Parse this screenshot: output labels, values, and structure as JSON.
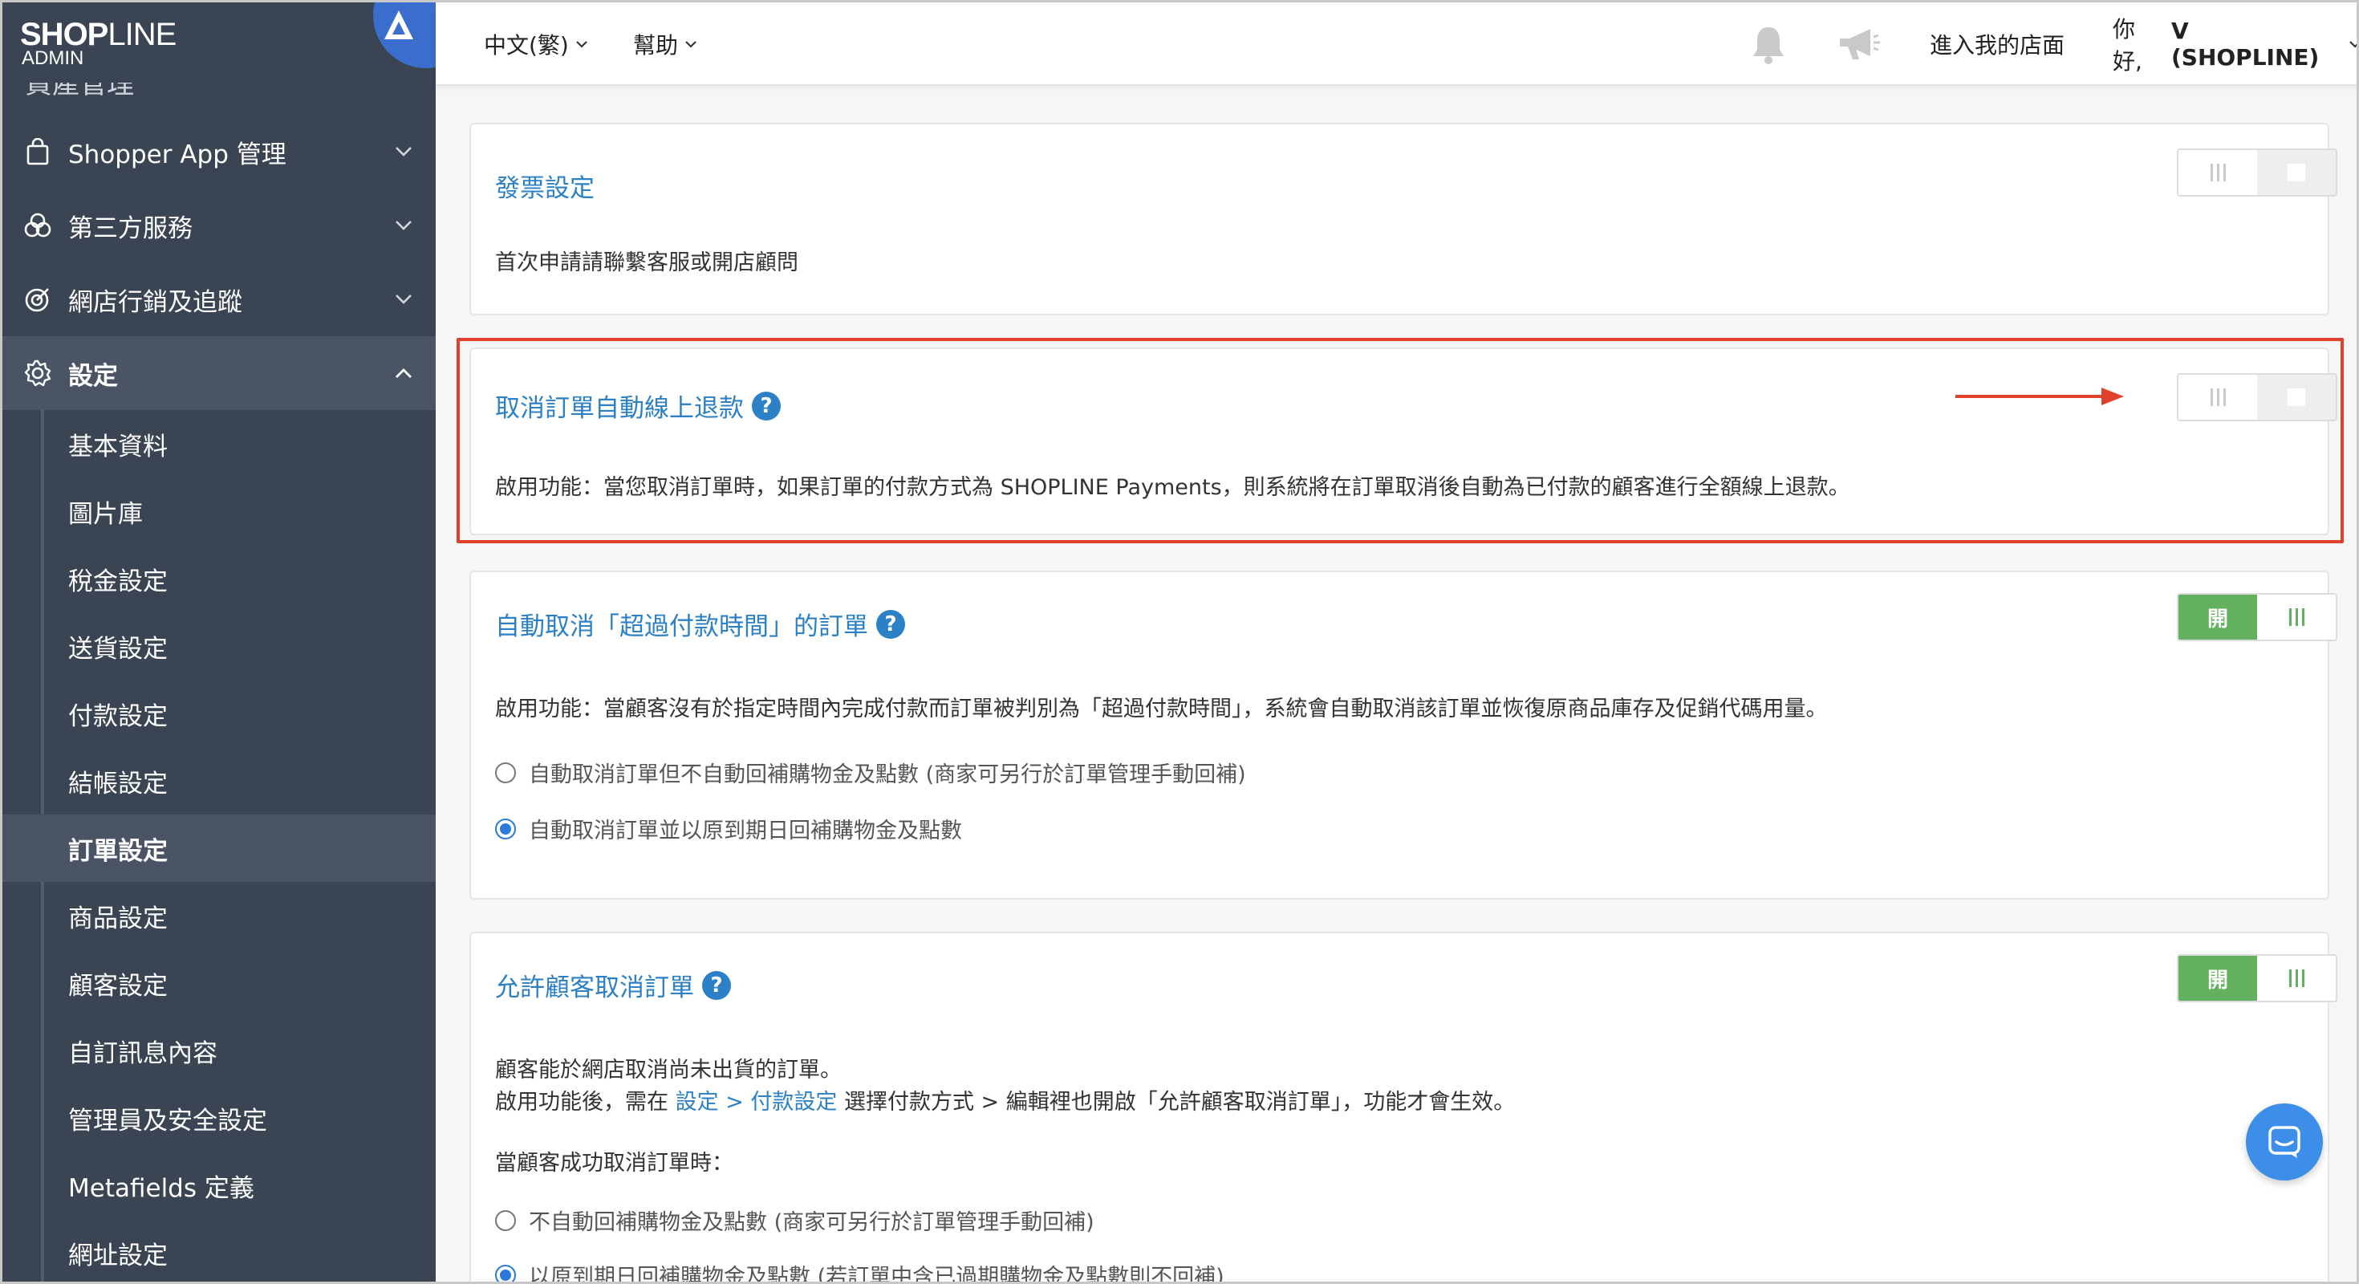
{
  "brand": {
    "name_bold": "SHOP",
    "name_light": "LINE",
    "sub": "ADMIN"
  },
  "sidebar": {
    "cut_label": "資產管理",
    "items": [
      {
        "label": "Shopper App 管理",
        "icon": "shopping-bag-icon"
      },
      {
        "label": "第三方服務",
        "icon": "integrations-icon"
      },
      {
        "label": "網店行銷及追蹤",
        "icon": "target-icon"
      },
      {
        "label": "設定",
        "icon": "gear-icon"
      }
    ],
    "sub_items": [
      {
        "label": "基本資料"
      },
      {
        "label": "圖片庫"
      },
      {
        "label": "稅金設定"
      },
      {
        "label": "送貨設定"
      },
      {
        "label": "付款設定"
      },
      {
        "label": "結帳設定"
      },
      {
        "label": "訂單設定"
      },
      {
        "label": "商品設定"
      },
      {
        "label": "顧客設定"
      },
      {
        "label": "自訂訊息內容"
      },
      {
        "label": "管理員及安全設定"
      },
      {
        "label": "Metafields 定義"
      },
      {
        "label": "網址設定"
      }
    ],
    "active_sub": "訂單設定"
  },
  "topbar": {
    "language": "中文(繁)",
    "help": "幫助",
    "store_link": "進入我的店面",
    "greeting": "你好,",
    "user": "V (SHOPLINE)"
  },
  "cards": {
    "invoice": {
      "title": "發票設定",
      "desc": "首次申請請聯繫客服或開店顧問",
      "enabled": false
    },
    "auto_refund": {
      "title": "取消訂單自動線上退款",
      "desc": "啟用功能：當您取消訂單時，如果訂單的付款方式為 SHOPLINE Payments，則系統將在訂單取消後自動為已付款的顧客進行全額線上退款。",
      "enabled": false
    },
    "auto_cancel": {
      "title": "自動取消「超過付款時間」的訂單",
      "desc": "啟用功能：當顧客沒有於指定時間內完成付款而訂單被判別為「超過付款時間」，系統會自動取消該訂單並恢復原商品庫存及促銷代碼用量。",
      "toggle_label": "開",
      "enabled": true,
      "options": [
        {
          "label": "自動取消訂單但不自動回補購物金及點數 (商家可另行於訂單管理手動回補)",
          "checked": false
        },
        {
          "label": "自動取消訂單並以原到期日回補購物金及點數",
          "checked": true
        }
      ]
    },
    "customer_cancel": {
      "title": "允許顧客取消訂單",
      "desc1": "顧客能於網店取消尚未出貨的訂單。",
      "desc2_a": "啟用功能後，需在 ",
      "desc2_link": "設定 > 付款設定",
      "desc2_b": " 選擇付款方式 > 編輯裡也開啟「允許顧客取消訂單」，功能才會生效。",
      "when_label": "當顧客成功取消訂單時：",
      "toggle_label": "開",
      "enabled": true,
      "options": [
        {
          "label": "不自動回補購物金及點數 (商家可另行於訂單管理手動回補)",
          "checked": false
        },
        {
          "label": "以原到期日回補購物金及點數 (若訂單中含已過期購物金及點數則不回補)",
          "checked": true
        }
      ]
    }
  },
  "colors": {
    "accent": "#2b80c6",
    "highlight": "#e0412c",
    "toggle_on": "#63b05f",
    "sidebar": "#3b4453"
  }
}
